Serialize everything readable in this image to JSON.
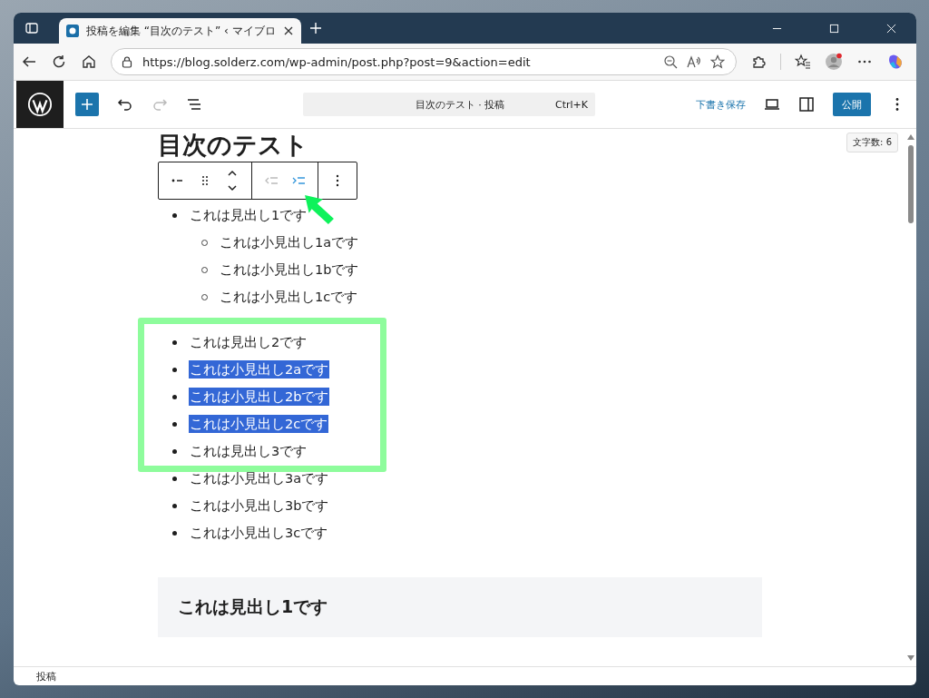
{
  "browser": {
    "tab": {
      "title": "投稿を編集 “目次のテスト” ‹ マイブロ",
      "selected": true
    },
    "url": "https://blog.solderz.com/wp-admin/post.php?post=9&action=edit"
  },
  "editor_toolbar": {
    "undo": {
      "disabled": false
    },
    "redo": {
      "disabled": true
    },
    "command_bar": {
      "title": "目次のテスト · 投稿",
      "shortcut": "Ctrl+K"
    },
    "save_draft": "下書き保存",
    "publish": "公開"
  },
  "word_count": "文字数: 6",
  "block_toolbar": {
    "outdent": {
      "disabled": true
    },
    "indent": {
      "disabled": false
    }
  },
  "post": {
    "title": "目次のテスト",
    "lists": [
      [
        {
          "text": "これは見出し1です",
          "selected": false,
          "children": [
            {
              "text": "これは小見出し1aです",
              "selected": false
            },
            {
              "text": "これは小見出し1bです",
              "selected": false
            },
            {
              "text": "これは小見出し1cです",
              "selected": false
            }
          ]
        }
      ],
      [
        {
          "text": "これは見出し2です",
          "selected": false
        },
        {
          "text": "これは小見出し2aです",
          "selected": true
        },
        {
          "text": "これは小見出し2bです",
          "selected": true
        },
        {
          "text": "これは小見出し2cです",
          "selected": true
        },
        {
          "text": "これは見出し3です",
          "selected": false
        },
        {
          "text": "これは小見出し3aです",
          "selected": false
        },
        {
          "text": "これは小見出し3bです",
          "selected": false
        },
        {
          "text": "これは小見出し3cです",
          "selected": false
        }
      ]
    ],
    "heading": "これは見出し1です"
  },
  "status_bar": "投稿"
}
